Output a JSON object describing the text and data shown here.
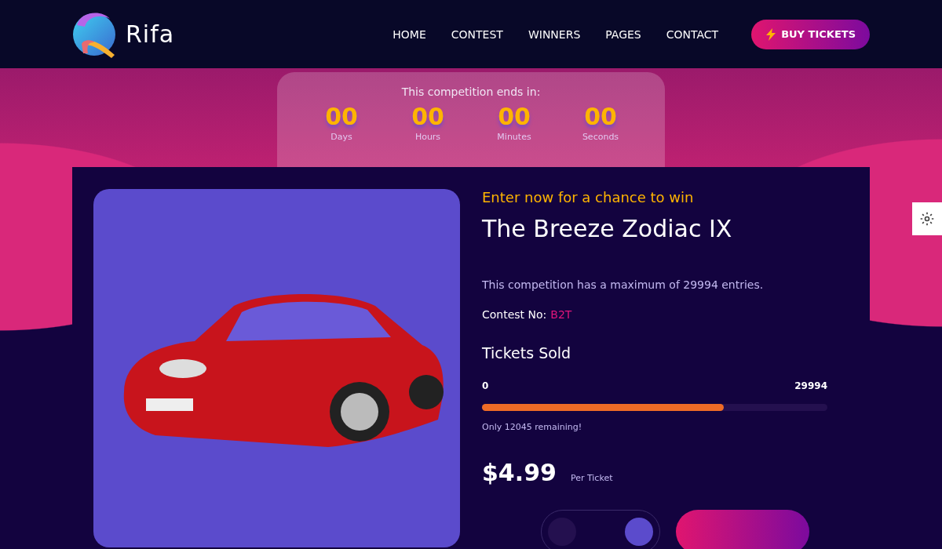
{
  "header": {
    "logo": "Rifa",
    "nav": [
      {
        "label": "HOME"
      },
      {
        "label": "CONTEST"
      },
      {
        "label": "WINNERS"
      },
      {
        "label": "PAGES"
      },
      {
        "label": "CONTACT"
      }
    ],
    "cta": "BUY TICKETS"
  },
  "countdown": {
    "title": "This competition ends in:",
    "units": [
      {
        "value": "00",
        "label": "Days"
      },
      {
        "value": "00",
        "label": "Hours"
      },
      {
        "value": "00",
        "label": "Minutes"
      },
      {
        "value": "00",
        "label": "Seconds"
      }
    ]
  },
  "contest": {
    "eyebrow": "Enter now for a chance to win",
    "title": "The Breeze Zodiac IX",
    "description": "This competition has a maximum of 29994 entries.",
    "contest_no_label": "Contest No:",
    "contest_no": "B2T",
    "tickets_heading": "Tickets Sold",
    "min": "0",
    "max": "29994",
    "level": 0.7,
    "remaining": "Only 12045 remaining!",
    "price": "$4.99",
    "price_unit": "Per Ticket"
  }
}
